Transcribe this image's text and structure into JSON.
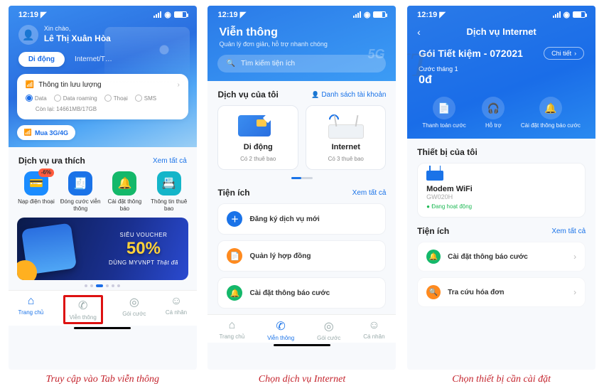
{
  "status": {
    "time": "12:19",
    "loc_icon": "◤"
  },
  "screen1": {
    "greeting_small": "Xin chào,",
    "greeting_name": "Lê Thị Xuân Hòa",
    "tab_active": "Di động",
    "tab_ghost": "Internet/T…",
    "info_title": "Thông tin lưu lượng",
    "radios": [
      "Data",
      "Data roaming",
      "Thoại",
      "SMS"
    ],
    "quota": "Còn lại: 14661MB/17GB",
    "buy": "Mua 3G/4G",
    "fav_title": "Dịch vụ ưa thích",
    "see_all": "Xem tất cả",
    "services": [
      {
        "label": "Nạp điện thoại",
        "badge": "-6%",
        "color": "#1a8cff"
      },
      {
        "label": "Đóng cước viễn thông",
        "color": "#1a73e8"
      },
      {
        "label": "Cài đặt thông báo",
        "color": "#14b86a"
      },
      {
        "label": "Thông tin thuê bao",
        "color": "#14b5c9"
      }
    ],
    "banner_top": "SIÊU VOUCHER",
    "banner_pct": "50%",
    "banner_sub1": "DÙNG MYVNPT",
    "banner_sub2": "Thật đã",
    "nav": [
      "Trang chủ",
      "Viễn thông",
      "Gói cước",
      "Cá nhân"
    ]
  },
  "screen2": {
    "title": "Viễn thông",
    "subtitle": "Quản lý đơn giản, hỗ trợ nhanh chóng",
    "search_ph": "Tìm kiếm tiện ích",
    "my_services": "Dịch vụ của tôi",
    "account_list": "Danh sách tài khoản",
    "cards": [
      {
        "name": "Di động",
        "sub": "Có 2 thuê bao"
      },
      {
        "name": "Internet",
        "sub": "Có 3 thuê bao"
      }
    ],
    "utilities_title": "Tiện ích",
    "see_all": "Xem tất cả",
    "utils": [
      {
        "label": "Đăng ký dịch vụ mới",
        "color": "#1a73e8"
      },
      {
        "label": "Quản lý hợp đồng",
        "color": "#ff8a1e"
      },
      {
        "label": "Cài đặt thông báo cước",
        "color": "#14b86a"
      }
    ],
    "nav": [
      "Trang chủ",
      "Viễn thông",
      "Gói cước",
      "Cá nhân"
    ]
  },
  "screen3": {
    "header": "Dịch vụ Internet",
    "pkg": "Gói Tiết kiệm - 072021",
    "detail": "Chi tiết",
    "fee_label": "Cước tháng 1",
    "fee_amount": "0đ",
    "actions": [
      {
        "label": "Thanh toán cước",
        "icon": "📄"
      },
      {
        "label": "Hỗ trợ",
        "icon": "🎧"
      },
      {
        "label": "Cài đặt thông báo cước",
        "icon": "🔔"
      }
    ],
    "devices_title": "Thiết bị của tôi",
    "device": {
      "name": "Modem WiFi",
      "model": "GW020H",
      "status": "● Đang hoạt động"
    },
    "utilities_title": "Tiện ích",
    "see_all": "Xem tất cả",
    "utils": [
      {
        "label": "Cài đặt thông báo cước",
        "color": "#14b86a"
      },
      {
        "label": "Tra cứu hóa đơn",
        "color": "#ff8a1e"
      }
    ]
  },
  "captions": [
    "Truy cập vào Tab viễn thông",
    "Chọn dịch vụ Internet",
    "Chọn thiết bị cần cài đặt"
  ]
}
